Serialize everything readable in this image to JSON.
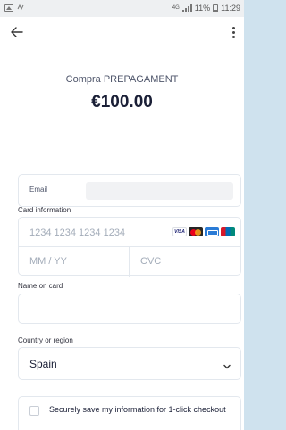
{
  "status_bar": {
    "network_label": "4G",
    "battery_percent": "11%",
    "time": "11:29"
  },
  "header": {
    "merchant": "Compra PREPAGAMENT",
    "amount": "€100.00"
  },
  "form": {
    "email_label": "Email",
    "card_label": "Card information",
    "card_number_placeholder": "1234 1234 1234 1234",
    "expiry_placeholder": "MM / YY",
    "cvc_placeholder": "CVC",
    "card_brands": [
      "visa",
      "mastercard",
      "amex",
      "unionpay"
    ],
    "visa_text": "VISA",
    "name_label": "Name on card",
    "name_value": "",
    "country_label": "Country or region",
    "country_value": "Spain",
    "save_label": "Securely save my information for 1-click checkout"
  },
  "colors": {
    "background": "#cfe2ee",
    "text": "#1a1f36",
    "placeholder": "#a3acb9",
    "border": "#e3e8ee"
  }
}
